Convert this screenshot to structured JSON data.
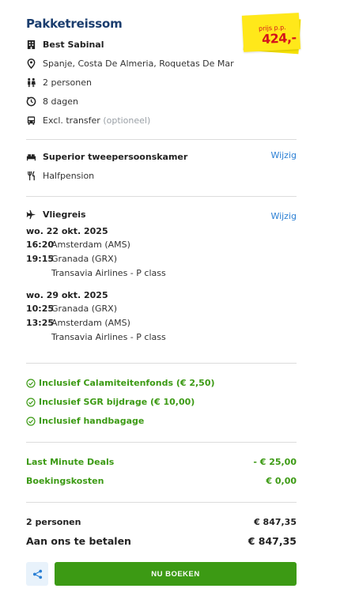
{
  "header": {
    "title": "Pakketreissom",
    "price_label": "prijs p.p.",
    "price_amount": "424,-"
  },
  "trip": {
    "hotel": "Best Sabinal",
    "location": "Spanje, Costa De Almeria, Roquetas De Mar",
    "persons": "2 personen",
    "duration": "8 dagen",
    "transfer": "Excl. transfer",
    "transfer_note": "(optioneel)"
  },
  "room": {
    "type": "Superior tweepersoonskamer",
    "board": "Halfpension",
    "change_label": "Wijzig"
  },
  "flight": {
    "heading": "Vliegreis",
    "change_label": "Wijzig",
    "outbound": {
      "date": "wo. 22 okt. 2025",
      "dep_time": "16:20",
      "dep_airport": "Amsterdam (AMS)",
      "arr_time": "19:15",
      "arr_airport": "Granada (GRX)",
      "airline": "Transavia Airlines - P class"
    },
    "return": {
      "date": "wo. 29 okt. 2025",
      "dep_time": "10:25",
      "dep_airport": "Granada (GRX)",
      "arr_time": "13:25",
      "arr_airport": "Amsterdam (AMS)",
      "airline": "Transavia Airlines - P class"
    }
  },
  "inclusions": [
    "Inclusief Calamiteitenfonds (€ 2,50)",
    "Inclusief SGR bijdrage (€ 10,00)",
    "Inclusief handbagage"
  ],
  "costs": {
    "discount_label": "Last Minute Deals",
    "discount_value": "- € 25,00",
    "booking_label": "Boekingskosten",
    "booking_value": "€ 0,00"
  },
  "totals": {
    "persons_label": "2 personen",
    "persons_value": "€ 847,35",
    "pay_label": "Aan ons te betalen",
    "pay_value": "€ 847,35"
  },
  "actions": {
    "book_label": "NU BOEKEN"
  },
  "colors": {
    "title": "#1a3d6e",
    "accent_green": "#3c9a14",
    "link_blue": "#2a7fd4",
    "sticker_yellow": "#ffe81a",
    "sticker_red": "#d4131c"
  }
}
